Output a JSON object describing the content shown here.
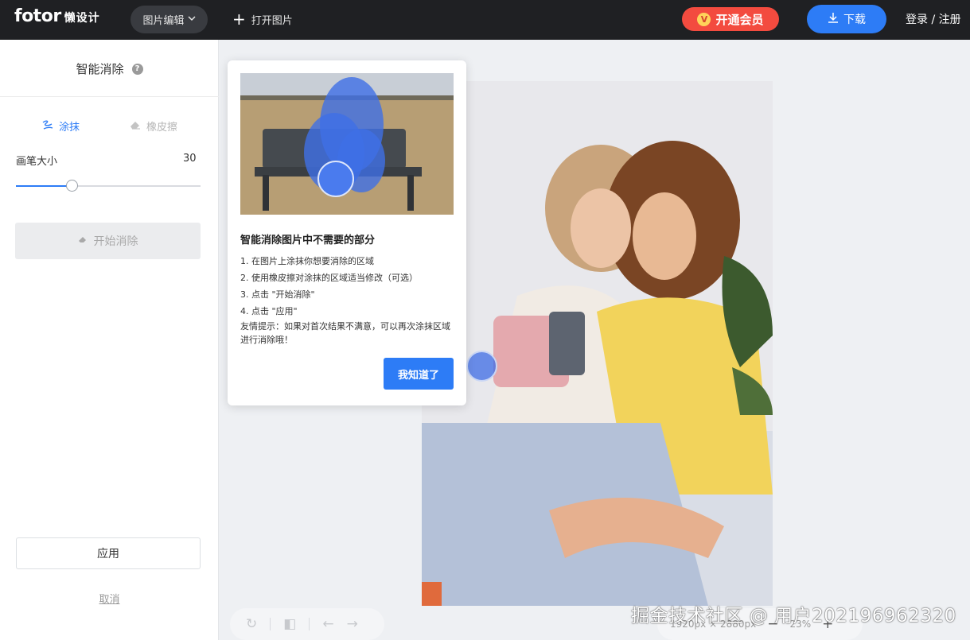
{
  "header": {
    "logo_brand": "fotor",
    "logo_sub": "懒设计",
    "menu_label": "图片编辑",
    "open_image_label": "打开图片",
    "vip_label": "开通会员",
    "download_label": "下载",
    "login_label": "登录 / 注册",
    "colors": {
      "bar": "#1f2023",
      "vip": "#f34b3f",
      "download": "#2d7cf6"
    }
  },
  "sidebar": {
    "title": "智能消除",
    "tools": [
      {
        "label": "涂抹",
        "icon": "brush-icon",
        "active": true
      },
      {
        "label": "橡皮擦",
        "icon": "eraser-icon",
        "active": false
      }
    ],
    "brush_size_label": "画笔大小",
    "brush_size_value": "30",
    "brush_slider_fraction": 0.3,
    "start_label": "开始消除",
    "apply_label": "应用",
    "cancel_label": "取消"
  },
  "popup": {
    "title": "智能消除图片中不需要的部分",
    "steps": [
      "1. 在图片上涂抹你想要消除的区域",
      "2. 使用橡皮擦对涂抹的区域适当修改（可选）",
      "3. 点击 \"开始消除\"",
      "4. 点击 \"应用\""
    ],
    "tip": "友情提示：如果对首次结果不满意，可以再次涂抹区域进行消除哦！",
    "ok_label": "我知道了"
  },
  "bottom": {
    "dimensions": "1920px × 2880px",
    "zoom": "23%"
  },
  "watermark": "掘金技术社区 @ 用户202196962320"
}
